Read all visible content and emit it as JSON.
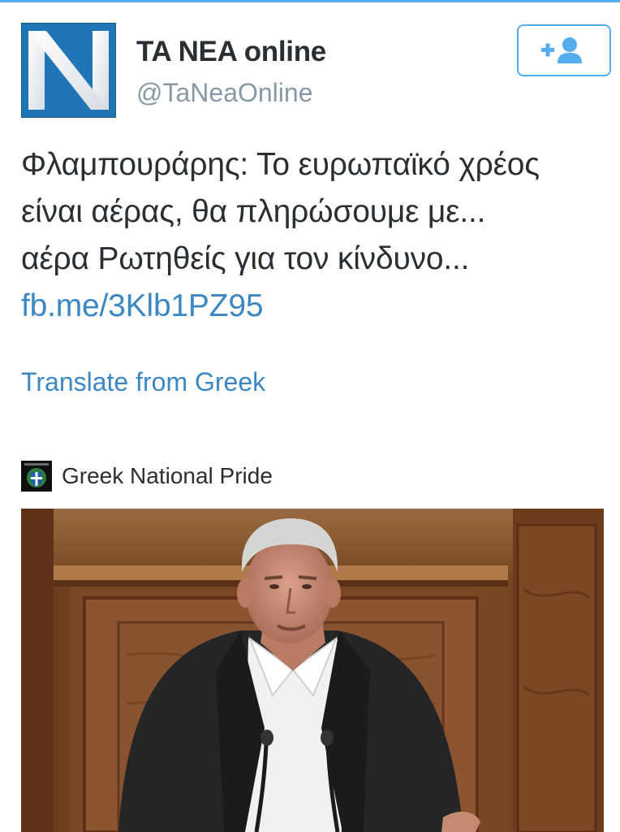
{
  "colors": {
    "accent": "#55acee",
    "link": "#3b88c3",
    "text": "#292f33",
    "muted": "#8899a6",
    "logo_blue": "#1f75b5"
  },
  "tweet": {
    "author": {
      "display_name": "TA NEA online",
      "handle": "@TaNeaOnline",
      "avatar_icon": "ta-nea-n-logo"
    },
    "follow_button": {
      "icon": "add-user-icon",
      "state": "not-following"
    },
    "text_lines": [
      "Φλαμπουράρης: Το ευρωπαϊκό χρέος",
      "είναι αέρας, θα πληρώσουμε με...",
      "αέρα Ρωτηθείς για τον κίνδυνο..."
    ],
    "link": "fb.me/3Klb1PZ95",
    "translate_label": "Translate from Greek"
  },
  "media": {
    "attribution": {
      "name": "Greek National Pride",
      "icon": "greek-coat-of-arms-icon"
    },
    "photo": {
      "subject": "speaker-at-podium",
      "icon": "photo"
    }
  }
}
